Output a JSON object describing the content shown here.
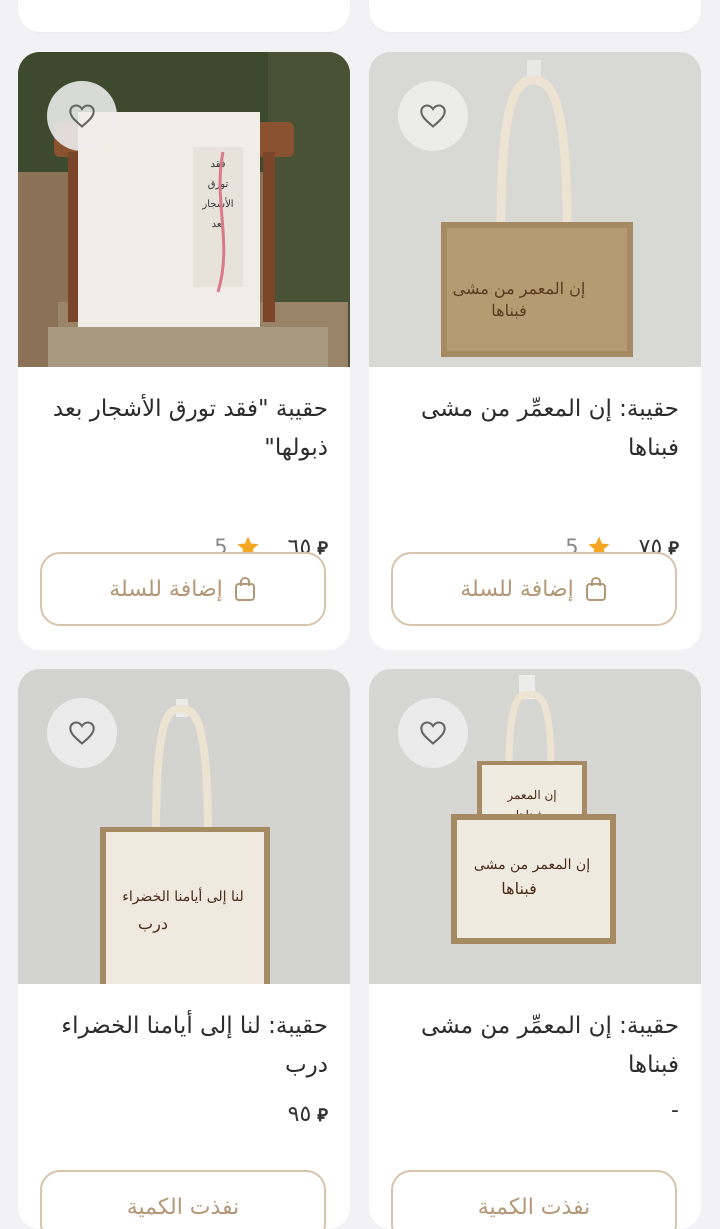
{
  "products": [
    {
      "title": "حقيبة: إن المعمِّر من مشى فبناها",
      "price": "٧٥",
      "currency": "⃁",
      "rating": "5",
      "cart_label": "إضافة للسلة"
    },
    {
      "title": "حقيبة \"فقد تورق الأشجار بعد ذبولها\"",
      "price": "٦٥",
      "currency": "⃁",
      "rating": "5",
      "cart_label": "إضافة للسلة"
    },
    {
      "title": "حقيبة: إن المعمِّر من مشى فبناها",
      "price": "-",
      "cart_label": "نفذت الكمية"
    },
    {
      "title": "حقيبة: لنا إلى أيامنا الخضراء درب",
      "price": "٩٥",
      "currency": "⃁",
      "cart_label": "نفذت الكمية"
    }
  ],
  "icons": {
    "favorite": "heart-icon",
    "cart": "shopping-bag-icon",
    "rating": "star-icon"
  },
  "colors": {
    "accent": "#b49776",
    "border": "#d8c3ad",
    "star": "#f5a623"
  }
}
